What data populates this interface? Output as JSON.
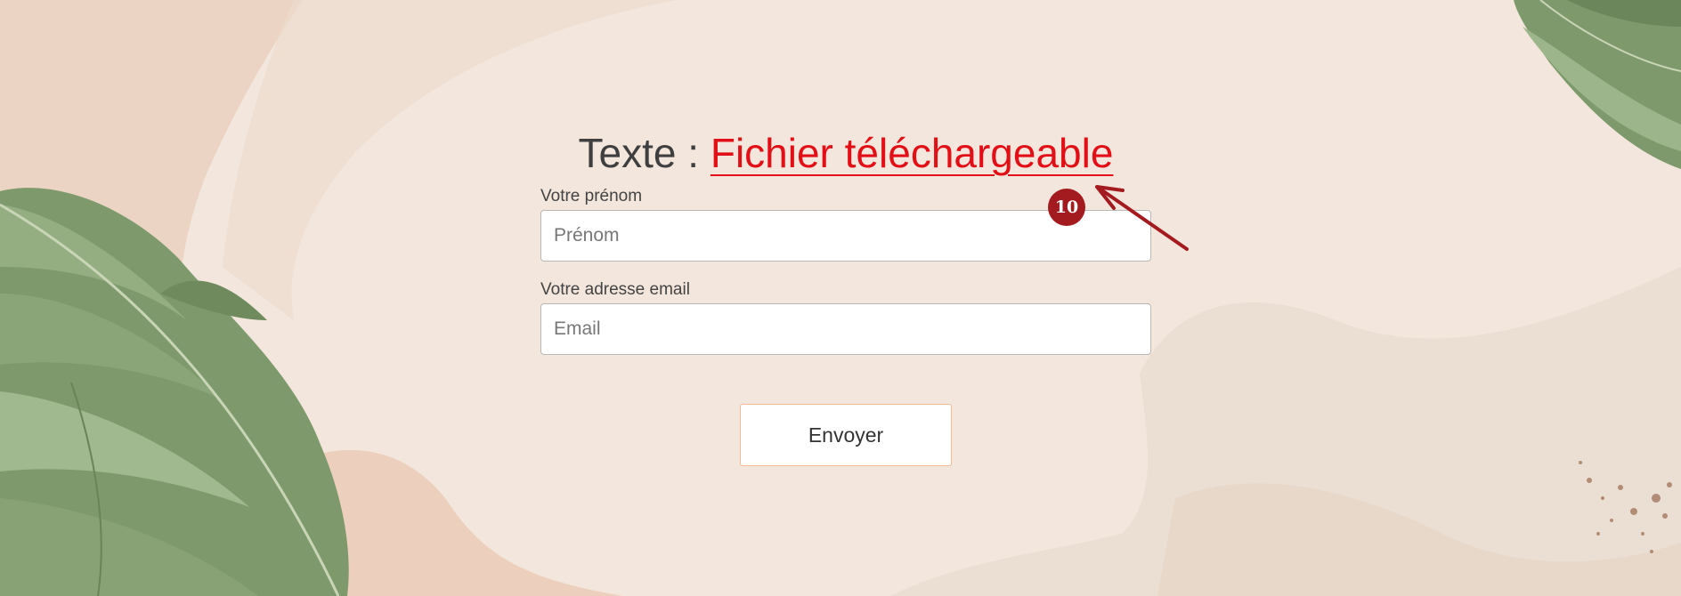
{
  "heading": {
    "prefix": "Texte : ",
    "link": "Fichier téléchargeable"
  },
  "form": {
    "firstname_label": "Votre prénom",
    "firstname_placeholder": "Prénom",
    "firstname_value": "",
    "email_label": "Votre adresse email",
    "email_placeholder": "Email",
    "email_value": "",
    "submit_label": "Envoyer"
  },
  "annotation": {
    "badge": "10",
    "color": "#a31a1f"
  },
  "colors": {
    "link": "#e21016",
    "button_border": "#f2b89a",
    "background": "#f3e6dc"
  },
  "background": {
    "decoration": "monstera-leaves-and-beige-shapes"
  }
}
